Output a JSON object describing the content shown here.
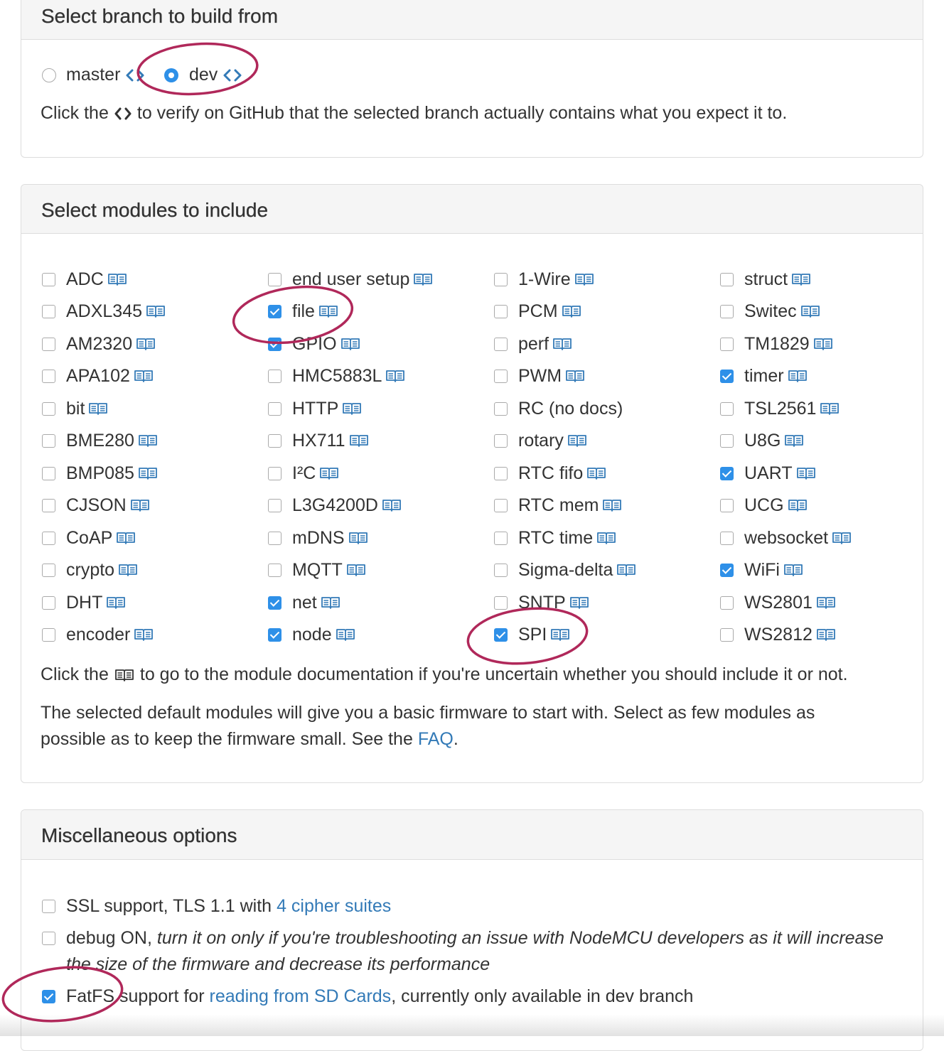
{
  "branch": {
    "title": "Select branch to build from",
    "options": [
      {
        "label": "master",
        "selected": false
      },
      {
        "label": "dev",
        "selected": true
      }
    ],
    "hint_prefix": "Click the",
    "hint_suffix": "to verify on GitHub that the selected branch actually contains what you expect it to."
  },
  "modules": {
    "title": "Select modules to include",
    "columns": [
      [
        {
          "label": "ADC",
          "checked": false,
          "doc": true
        },
        {
          "label": "ADXL345",
          "checked": false,
          "doc": true
        },
        {
          "label": "AM2320",
          "checked": false,
          "doc": true
        },
        {
          "label": "APA102",
          "checked": false,
          "doc": true
        },
        {
          "label": "bit",
          "checked": false,
          "doc": true
        },
        {
          "label": "BME280",
          "checked": false,
          "doc": true
        },
        {
          "label": "BMP085",
          "checked": false,
          "doc": true
        },
        {
          "label": "CJSON",
          "checked": false,
          "doc": true
        },
        {
          "label": "CoAP",
          "checked": false,
          "doc": true
        },
        {
          "label": "crypto",
          "checked": false,
          "doc": true
        },
        {
          "label": "DHT",
          "checked": false,
          "doc": true
        },
        {
          "label": "encoder",
          "checked": false,
          "doc": true
        }
      ],
      [
        {
          "label": "end user setup",
          "checked": false,
          "doc": true
        },
        {
          "label": "file",
          "checked": true,
          "doc": true
        },
        {
          "label": "GPIO",
          "checked": true,
          "doc": true
        },
        {
          "label": "HMC5883L",
          "checked": false,
          "doc": true
        },
        {
          "label": "HTTP",
          "checked": false,
          "doc": true
        },
        {
          "label": "HX711",
          "checked": false,
          "doc": true
        },
        {
          "label": "I²C",
          "checked": false,
          "doc": true
        },
        {
          "label": "L3G4200D",
          "checked": false,
          "doc": true
        },
        {
          "label": "mDNS",
          "checked": false,
          "doc": true
        },
        {
          "label": "MQTT",
          "checked": false,
          "doc": true
        },
        {
          "label": "net",
          "checked": true,
          "doc": true
        },
        {
          "label": "node",
          "checked": true,
          "doc": true
        }
      ],
      [
        {
          "label": "1-Wire",
          "checked": false,
          "doc": true
        },
        {
          "label": "PCM",
          "checked": false,
          "doc": true
        },
        {
          "label": "perf",
          "checked": false,
          "doc": true
        },
        {
          "label": "PWM",
          "checked": false,
          "doc": true
        },
        {
          "label": "RC (no docs)",
          "checked": false,
          "doc": false
        },
        {
          "label": "rotary",
          "checked": false,
          "doc": true
        },
        {
          "label": "RTC fifo",
          "checked": false,
          "doc": true
        },
        {
          "label": "RTC mem",
          "checked": false,
          "doc": true
        },
        {
          "label": "RTC time",
          "checked": false,
          "doc": true
        },
        {
          "label": "Sigma-delta",
          "checked": false,
          "doc": true
        },
        {
          "label": "SNTP",
          "checked": false,
          "doc": true
        },
        {
          "label": "SPI",
          "checked": true,
          "doc": true
        }
      ],
      [
        {
          "label": "struct",
          "checked": false,
          "doc": true
        },
        {
          "label": "Switec",
          "checked": false,
          "doc": true
        },
        {
          "label": "TM1829",
          "checked": false,
          "doc": true
        },
        {
          "label": "timer",
          "checked": true,
          "doc": true
        },
        {
          "label": "TSL2561",
          "checked": false,
          "doc": true
        },
        {
          "label": "U8G",
          "checked": false,
          "doc": true
        },
        {
          "label": "UART",
          "checked": true,
          "doc": true
        },
        {
          "label": "UCG",
          "checked": false,
          "doc": true
        },
        {
          "label": "websocket",
          "checked": false,
          "doc": true
        },
        {
          "label": "WiFi",
          "checked": true,
          "doc": true
        },
        {
          "label": "WS2801",
          "checked": false,
          "doc": true
        },
        {
          "label": "WS2812",
          "checked": false,
          "doc": true
        }
      ]
    ],
    "doc_hint_prefix": "Click the",
    "doc_hint_suffix": "to go to the module documentation if you're uncertain whether you should include it or not.",
    "note_line1": "The selected default modules will give you a basic firmware to start with. Select as few modules as",
    "note_line2_prefix": "possible as to keep the firmware small. See the",
    "note_faq_link": "FAQ",
    "note_line2_suffix": "."
  },
  "misc": {
    "title": "Miscellaneous options",
    "ssl": {
      "checked": false,
      "label": "SSL support, TLS 1.1 with",
      "link": "4 cipher suites"
    },
    "debug": {
      "checked": false,
      "label": "debug ON,",
      "italic_line1": "turn it on only if you're troubleshooting an issue with NodeMCU developers as it will increase",
      "italic_line2": "the size of the firmware and decrease its performance"
    },
    "fatfs": {
      "checked": true,
      "label": "FatFS support for",
      "link": "reading from SD Cards",
      "suffix": ", currently only available in dev branch"
    }
  },
  "colors": {
    "accent": "#2e90e8",
    "link": "#337ab7",
    "annotation": "#b0285a",
    "panel_heading_bg": "#f5f5f5"
  },
  "icons": {
    "code": "code-brackets-icon",
    "doc": "book-icon"
  }
}
